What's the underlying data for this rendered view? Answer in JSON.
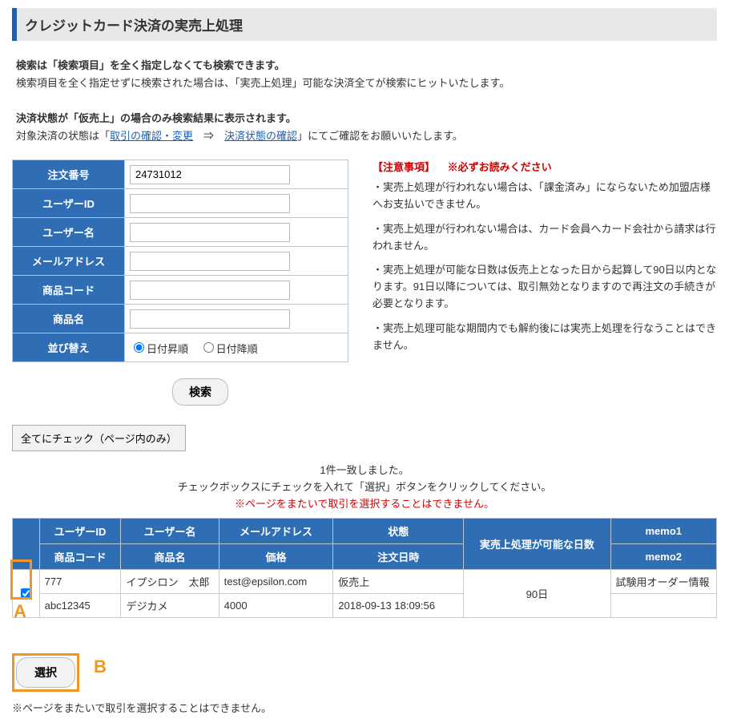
{
  "title": "クレジットカード決済の実売上処理",
  "intro": {
    "line1_bold": "検索は「検索項目」を全く指定しなくても検索できます。",
    "line2": "検索項目を全く指定せずに検索された場合は、「実売上処理」可能な決済全てが検索にヒットいたします。",
    "line3_bold": "決済状態が「仮売上」の場合のみ検索結果に表示されます。",
    "line4_pre": "対象決済の状態は「",
    "link1": "取引の確認・変更",
    "arrow": "　⇒　",
    "link2": "決済状態の確認",
    "line4_post": "」にてご確認をお願いいたします。"
  },
  "search": {
    "labels": {
      "order_no": "注文番号",
      "user_id": "ユーザーID",
      "user_name": "ユーザー名",
      "email": "メールアドレス",
      "item_code": "商品コード",
      "item_name": "商品名",
      "sort": "並び替え"
    },
    "values": {
      "order_no": "24731012",
      "user_id": "",
      "user_name": "",
      "email": "",
      "item_code": "",
      "item_name": ""
    },
    "sort_asc": "日付昇順",
    "sort_desc": "日付降順",
    "btn_search": "検索"
  },
  "notice": {
    "hdr1": "【注意事項】",
    "hdr2": "※必ずお読みください",
    "p1": "・実売上処理が行われない場合は、「課金済み」にならないため加盟店様へお支払いできません。",
    "p2": "・実売上処理が行われない場合は、カード会員へカード会社から請求は行われません。",
    "p3": "・実売上処理が可能な日数は仮売上となった日から起算して90日以内となります。91日以降については、取引無効となりますので再注文の手続きが必要となります。",
    "p4": "・実売上処理可能な期間内でも解約後には実売上処理を行なうことはできません。"
  },
  "btn_check_all": "全てにチェック（ページ内のみ）",
  "result_msg": {
    "count": "1件一致しました。",
    "guide": "チェックボックスにチェックを入れて「選択」ボタンをクリックしてください。",
    "warn": "※ページをまたいで取引を選択することはできません。"
  },
  "result": {
    "headers": {
      "user_id": "ユーザーID",
      "user_name": "ユーザー名",
      "email": "メールアドレス",
      "status": "状態",
      "days": "実売上処理が可能な日数",
      "memo1": "memo1",
      "item_code": "商品コード",
      "item_name": "商品名",
      "price": "価格",
      "order_date": "注文日時",
      "memo2": "memo2"
    },
    "rows": [
      {
        "user_id": "777",
        "user_name": "イプシロン　太郎",
        "email": "test@epsilon.com",
        "status": "仮売上",
        "days": "90日",
        "memo1": "試験用オーダー情報",
        "item_code": "abc12345",
        "item_name": "デジカメ",
        "price": "4000",
        "order_date": "2018-09-13 18:09:56",
        "memo2": ""
      }
    ]
  },
  "callout": {
    "A": "A",
    "B": "B"
  },
  "btn_select": "選択",
  "foot_note": "※ページをまたいで取引を選択することはできません。"
}
